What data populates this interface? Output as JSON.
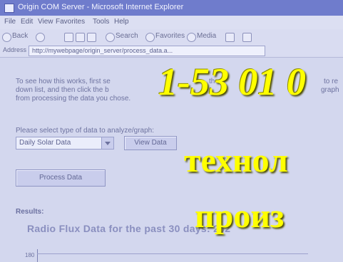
{
  "window": {
    "title": "Origin COM Server - Microsoft Internet Explorer"
  },
  "menu": [
    "File",
    "Edit",
    "View",
    "Favorites",
    "Tools",
    "Help"
  ],
  "toolbar": {
    "back": "Back",
    "search": "Search",
    "favorites": "Favorites",
    "media": "Media"
  },
  "address": {
    "label": "Address",
    "url": "http://mywebpage/origin_server/process_data.a..."
  },
  "content": {
    "intro_line1": "To see how this works, first se",
    "intro_line2": "down list, and then click the b",
    "intro_line3": "from processing the data you chose.",
    "intro_mid1": "the",
    "intro_tail1": "to re",
    "intro_tail2": "graph",
    "select_prompt": "Please select type of data to analyze/graph:",
    "select_value": "Daily Solar Data",
    "view_button": "View Data",
    "process_button": "Process Data",
    "results_label": "Results:",
    "chart_title": "Radio Flux Data for the past 30 days:  202",
    "y_tick": "180"
  },
  "overlay": {
    "line1": "1-53 01 0",
    "line2": "технол",
    "line3": "произ"
  }
}
